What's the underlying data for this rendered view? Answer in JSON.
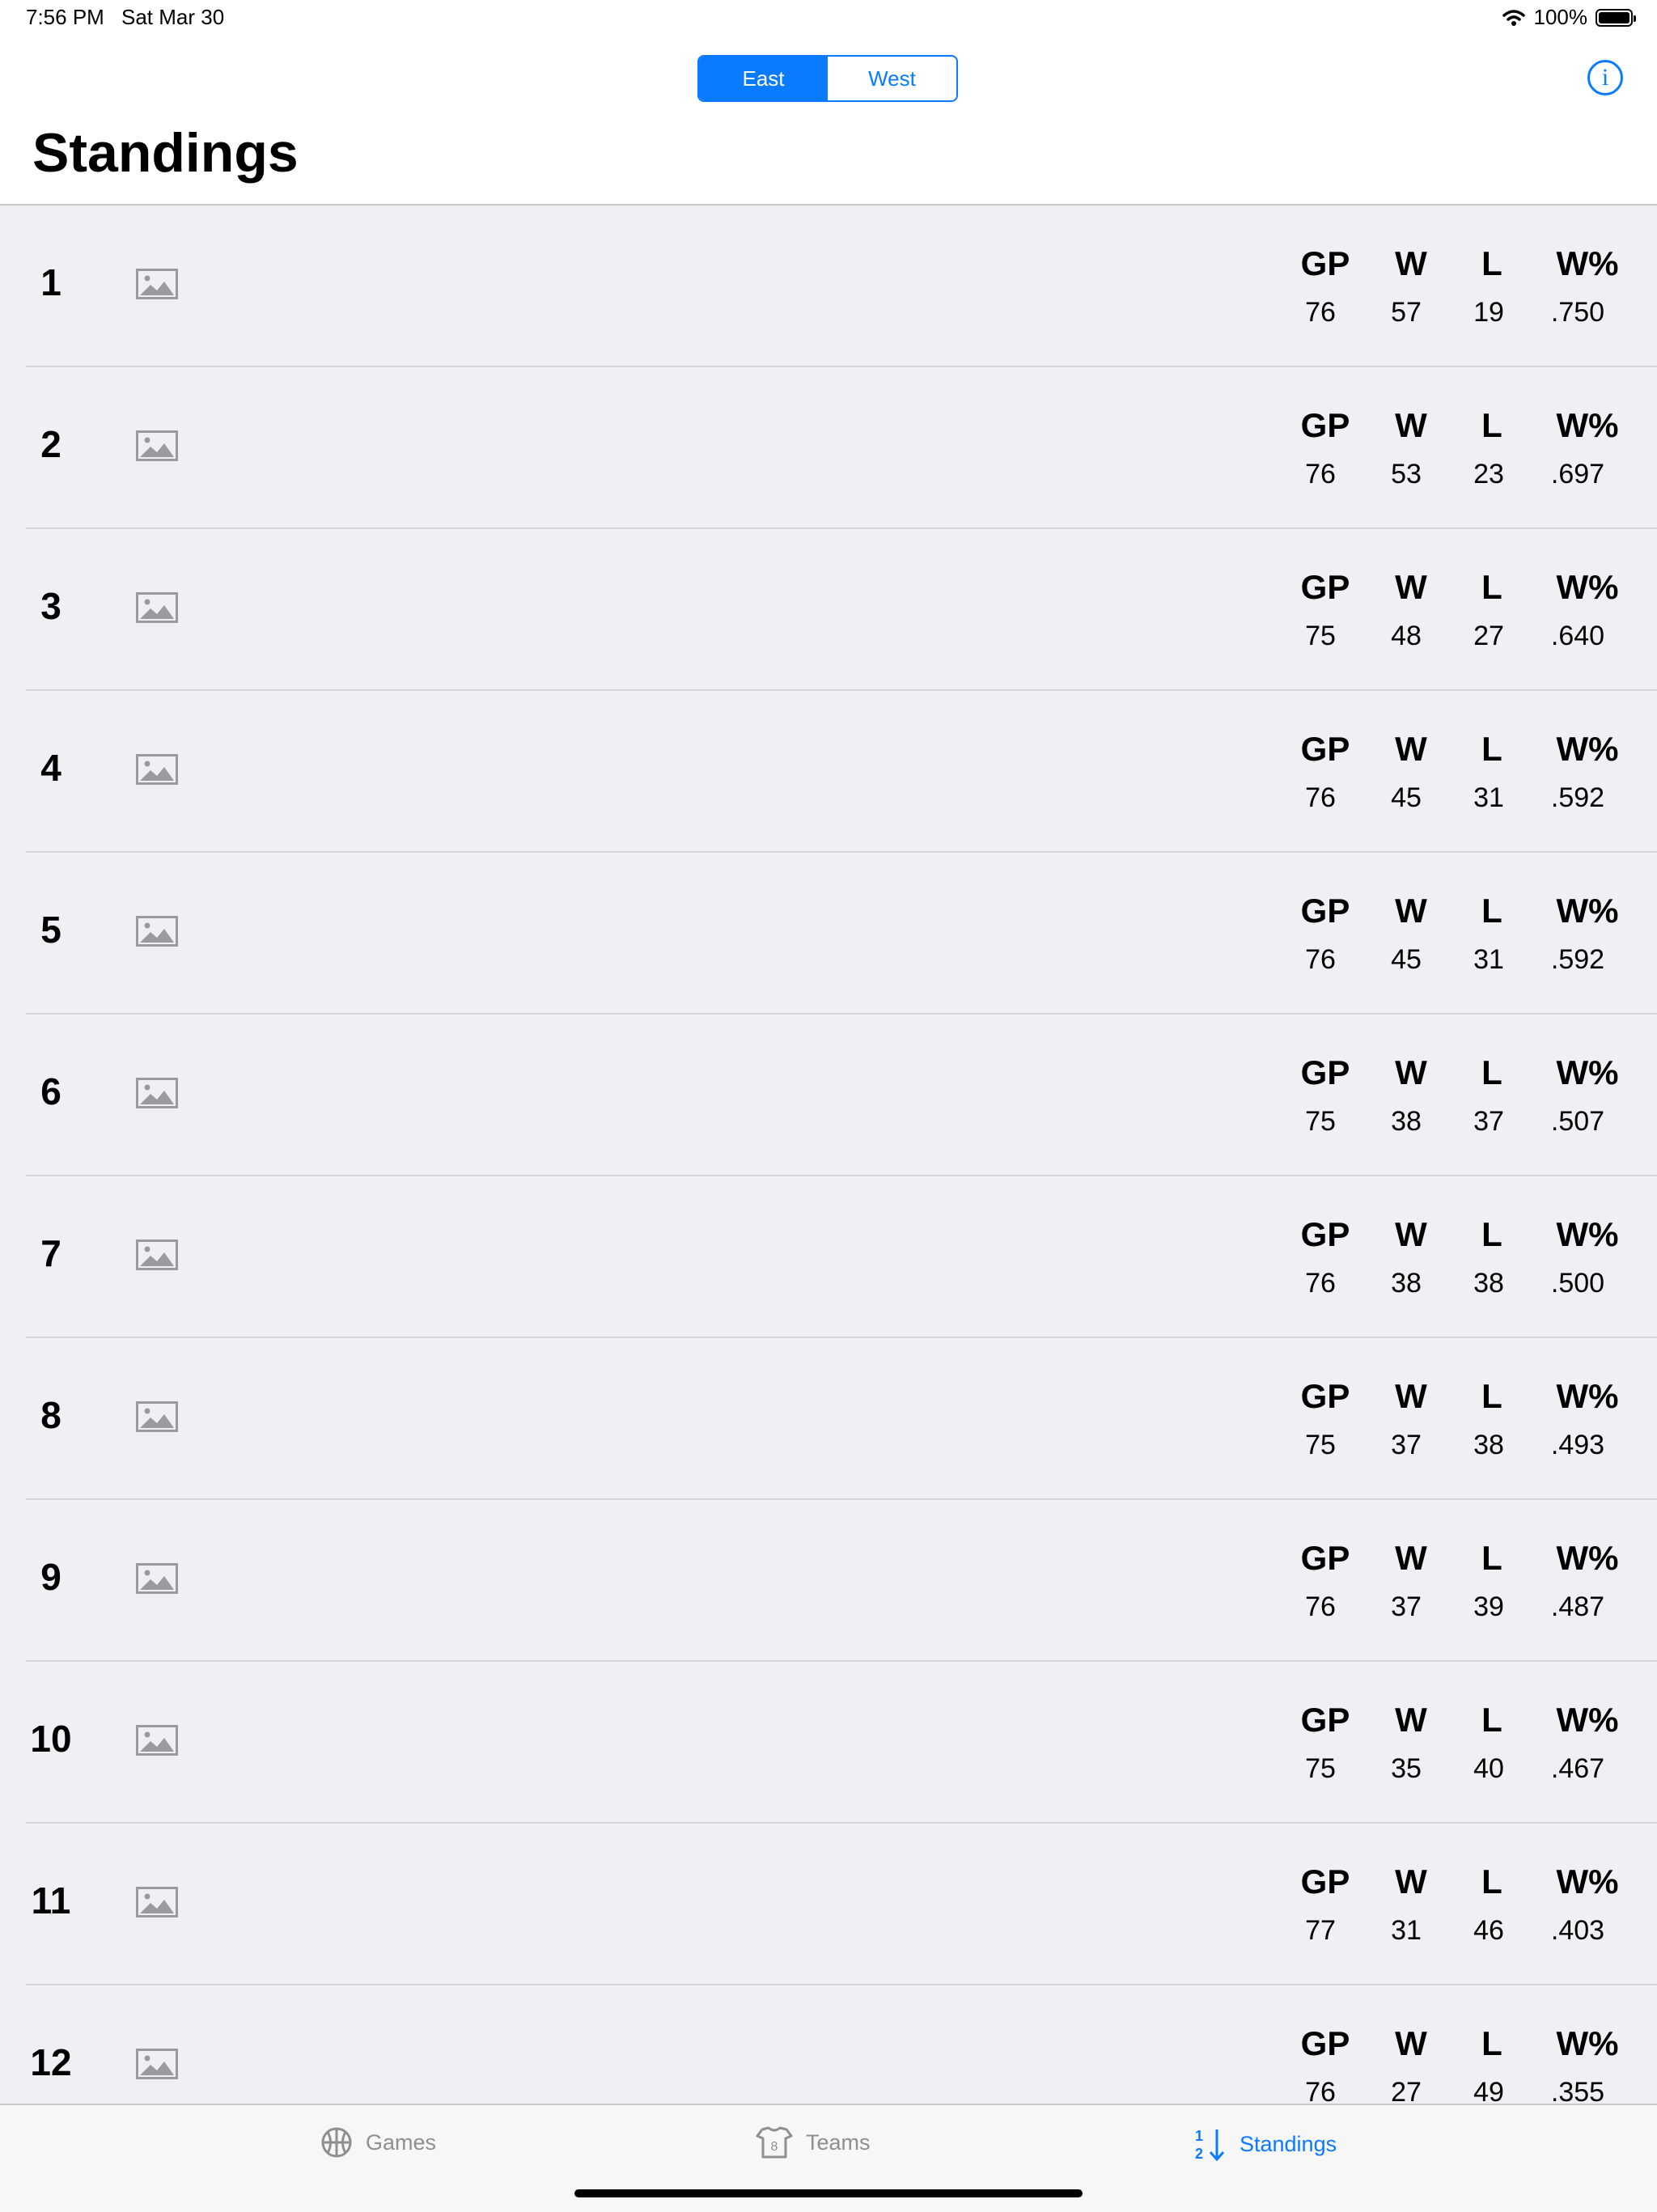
{
  "status_bar": {
    "time": "7:56 PM",
    "date": "Sat Mar 30",
    "battery": "100%"
  },
  "conference_switch": {
    "options": [
      "East",
      "West"
    ],
    "selected": "East"
  },
  "title": "Standings",
  "stat_headers": {
    "gp": "GP",
    "w": "W",
    "l": "L",
    "pct": "W%"
  },
  "rows": [
    {
      "rank": "1",
      "gp": "76",
      "w": "57",
      "l": "19",
      "pct": ".750"
    },
    {
      "rank": "2",
      "gp": "76",
      "w": "53",
      "l": "23",
      "pct": ".697"
    },
    {
      "rank": "3",
      "gp": "75",
      "w": "48",
      "l": "27",
      "pct": ".640"
    },
    {
      "rank": "4",
      "gp": "76",
      "w": "45",
      "l": "31",
      "pct": ".592"
    },
    {
      "rank": "5",
      "gp": "76",
      "w": "45",
      "l": "31",
      "pct": ".592"
    },
    {
      "rank": "6",
      "gp": "75",
      "w": "38",
      "l": "37",
      "pct": ".507"
    },
    {
      "rank": "7",
      "gp": "76",
      "w": "38",
      "l": "38",
      "pct": ".500"
    },
    {
      "rank": "8",
      "gp": "75",
      "w": "37",
      "l": "38",
      "pct": ".493"
    },
    {
      "rank": "9",
      "gp": "76",
      "w": "37",
      "l": "39",
      "pct": ".487"
    },
    {
      "rank": "10",
      "gp": "75",
      "w": "35",
      "l": "40",
      "pct": ".467"
    },
    {
      "rank": "11",
      "gp": "77",
      "w": "31",
      "l": "46",
      "pct": ".403"
    },
    {
      "rank": "12",
      "gp": "76",
      "w": "27",
      "l": "49",
      "pct": ".355"
    }
  ],
  "tabs": [
    {
      "label": "Games",
      "icon": "basketball-icon"
    },
    {
      "label": "Teams",
      "icon": "jersey-icon"
    },
    {
      "label": "Standings",
      "icon": "sort-numbers-icon"
    }
  ],
  "active_tab": "Standings",
  "colors": {
    "accent": "#0a7aff",
    "list_background": "#efeff4",
    "inactive_tab": "#8e8e93"
  }
}
